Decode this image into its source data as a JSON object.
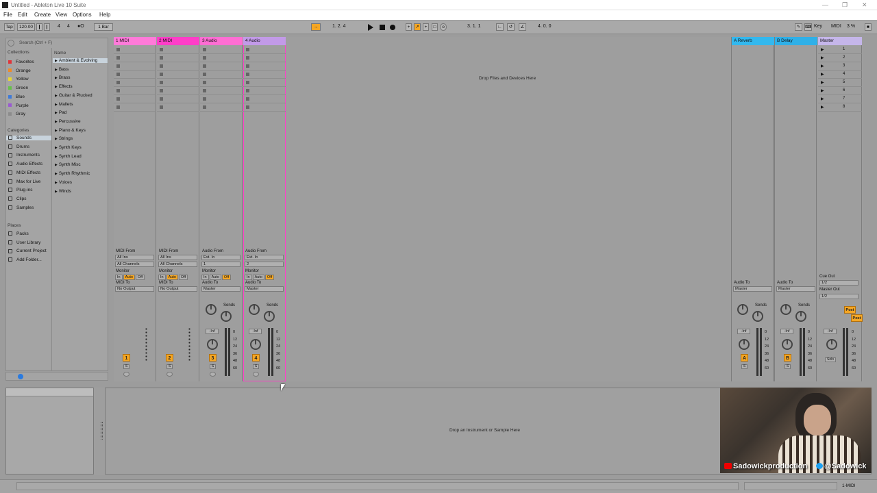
{
  "window": {
    "title": "Untitled - Ableton Live 10 Suite"
  },
  "menu": [
    "File",
    "Edit",
    "Create",
    "View",
    "Options",
    "Help"
  ],
  "control_bar": {
    "tap": "Tap",
    "tempo": "120.00",
    "sig_num": "4",
    "sig_den": "4",
    "quant": "1 Bar",
    "position": "1.   2.   4",
    "loop_start": "3.   1.   1",
    "loop_length": "4.   0.   0",
    "key": "Key",
    "midi": "MIDI",
    "cpu": "3 %"
  },
  "browser": {
    "search_placeholder": "Search (Ctrl + F)",
    "collections_label": "Collections",
    "name_header": "Name",
    "categories_label": "Categories",
    "places_label": "Places",
    "collections": [
      {
        "label": "Favorites",
        "color": "#e0353a"
      },
      {
        "label": "Orange",
        "color": "#f08a28"
      },
      {
        "label": "Yellow",
        "color": "#e8d534"
      },
      {
        "label": "Green",
        "color": "#66c04a"
      },
      {
        "label": "Blue",
        "color": "#3e7ad8"
      },
      {
        "label": "Purple",
        "color": "#9a5ad0"
      },
      {
        "label": "Gray",
        "color": "#8c8c8c"
      }
    ],
    "categories": [
      "Sounds",
      "Drums",
      "Instruments",
      "Audio Effects",
      "MIDI Effects",
      "Max for Live",
      "Plug-ins",
      "Clips",
      "Samples"
    ],
    "places": [
      "Packs",
      "User Library",
      "Current Project",
      "Add Folder..."
    ],
    "items": [
      "Ambient & Evolving",
      "Bass",
      "Brass",
      "Effects",
      "Guitar & Plucked",
      "Mallets",
      "Pad",
      "Percussive",
      "Piano & Keys",
      "Strings",
      "Synth Keys",
      "Synth Lead",
      "Synth Misc",
      "Synth Rhythmic",
      "Voices",
      "Winds"
    ]
  },
  "tracks": [
    {
      "name": "1 MIDI",
      "color": "#ff7ad9",
      "type": "midi",
      "from_label": "MIDI From",
      "from": "All Ins",
      "channel": "All Channels",
      "to_label": "MIDI To",
      "to": "No Output",
      "num": "1"
    },
    {
      "name": "2 MIDI",
      "color": "#ff3ec8",
      "type": "midi",
      "from_label": "MIDI From",
      "from": "All Ins",
      "channel": "All Channels",
      "to_label": "MIDI To",
      "to": "No Output",
      "num": "2"
    },
    {
      "name": "3 Audio",
      "color": "#ff6ed3",
      "type": "audio",
      "from_label": "Audio From",
      "from": "Ext. In",
      "channel": "1",
      "to_label": "Audio To",
      "to": "Master",
      "num": "3"
    },
    {
      "name": "4 Audio",
      "color": "#c29ae8",
      "type": "audio",
      "from_label": "Audio From",
      "from": "Ext. In",
      "channel": "2",
      "to_label": "Audio To",
      "to": "Master",
      "num": "4"
    }
  ],
  "returns": [
    {
      "name": "A Reverb",
      "color": "#33b8ee",
      "to_label": "Audio To",
      "to": "Master",
      "num": "A"
    },
    {
      "name": "B Delay",
      "color": "#2fb0e8",
      "to_label": "Audio To",
      "to": "Master",
      "num": "B"
    }
  ],
  "master": {
    "name": "Master",
    "color": "#c5b6ea",
    "cue_label": "Cue Out",
    "cue": "1/2",
    "out_label": "Master Out",
    "out": "1/2",
    "post": "Post",
    "solo": "Solo"
  },
  "scenes": [
    "1",
    "2",
    "3",
    "4",
    "5",
    "6",
    "7",
    "8"
  ],
  "mixer": {
    "monitor_label": "Monitor",
    "mon_in": "In",
    "mon_auto": "Auto",
    "mon_off": "Off",
    "sends_label": "Sends",
    "vol": "-Inf",
    "solo": "S",
    "scale": [
      "0",
      "12",
      "24",
      "36",
      "48",
      "60"
    ]
  },
  "drop_files": "Drop Files and Devices Here",
  "drop_instrument": "Drop an Instrument or Sample Here",
  "webcam": {
    "youtube": "Sadowickproduction",
    "twitter": "@Sadowick"
  },
  "status": {
    "track": "1-MIDI"
  }
}
